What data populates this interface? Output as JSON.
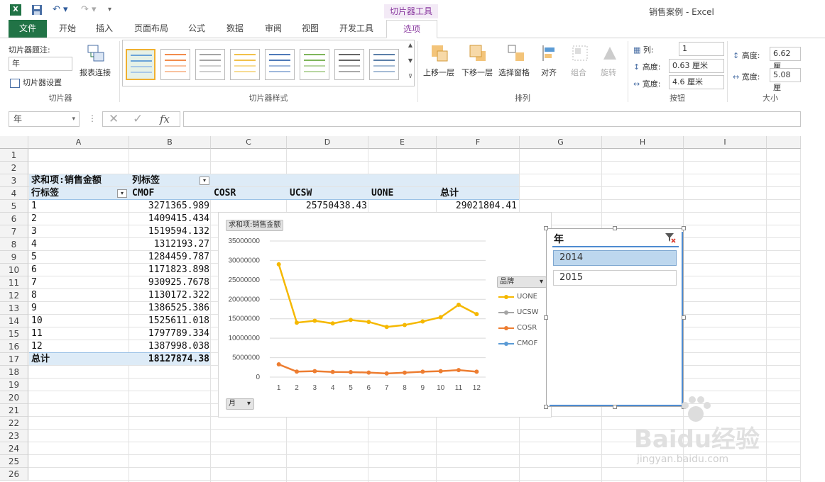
{
  "window": {
    "title": "销售案例 - Excel",
    "context_tools": "切片器工具"
  },
  "tabs": [
    "文件",
    "开始",
    "插入",
    "页面布局",
    "公式",
    "数据",
    "审阅",
    "视图",
    "开发工具",
    "选项"
  ],
  "ribbon": {
    "slicer_caption_label": "切片器题注:",
    "slicer_caption_value": "年",
    "slicer_settings": "切片器设置",
    "report_connections": "报表连接",
    "group_slicer": "切片器",
    "group_styles": "切片器样式",
    "bring_forward": "上移一层",
    "send_backward": "下移一层",
    "selection_pane": "选择窗格",
    "align": "对齐",
    "group_btn": "组合",
    "rotate": "旋转",
    "group_arrange": "排列",
    "columns_label": "列:",
    "columns_value": "1",
    "btn_height_label": "高度:",
    "btn_height_value": "0.63 厘米",
    "btn_width_label": "宽度:",
    "btn_width_value": "4.6 厘米",
    "group_buttons": "按钮",
    "size_height_label": "高度:",
    "size_height_value": "6.62 厘",
    "size_width_label": "宽度:",
    "size_width_value": "5.08 厘",
    "group_size": "大小"
  },
  "formula_bar": {
    "name_box": "年",
    "fx": "fx",
    "content": ""
  },
  "sheet": {
    "columns": [
      "A",
      "B",
      "C",
      "D",
      "E",
      "F",
      "G",
      "H",
      "I"
    ],
    "rows": [
      "1",
      "2",
      "3",
      "4",
      "5",
      "6",
      "7",
      "8",
      "9",
      "10",
      "11",
      "12",
      "13",
      "14",
      "15",
      "16",
      "17",
      "18",
      "19",
      "20",
      "21",
      "22",
      "23",
      "24",
      "25",
      "26"
    ],
    "pivot": {
      "sum_label": "求和项:销售金额",
      "col_label": "列标签",
      "row_label": "行标签",
      "headers": [
        "CMOF",
        "COSR",
        "UCSW",
        "UONE",
        "总计"
      ],
      "months": [
        "1",
        "2",
        "3",
        "4",
        "5",
        "6",
        "7",
        "8",
        "9",
        "10",
        "11",
        "12"
      ],
      "cmof": [
        "3271365.989",
        "1409415.434",
        "1519594.132",
        "1312193.27",
        "1284459.787",
        "1171823.898",
        "930925.7678",
        "1130172.322",
        "1386525.386",
        "1525611.018",
        "1797789.334",
        "1387998.038"
      ],
      "row5_ucsw": "25750438.43",
      "row5_total": "29021804.41",
      "total_label": "总计",
      "total_cmof": "18127874.38"
    }
  },
  "chart_data": {
    "type": "line",
    "field_button": "求和项:销售金额",
    "x_field_button": "月",
    "legend_field_button": "品牌",
    "categories": [
      "1",
      "2",
      "3",
      "4",
      "5",
      "6",
      "7",
      "8",
      "9",
      "10",
      "11",
      "12"
    ],
    "y_ticks": [
      "35000000",
      "30000000",
      "25000000",
      "20000000",
      "15000000",
      "10000000",
      "5000000",
      "0"
    ],
    "ylim": [
      0,
      35000000
    ],
    "legend_position": "right",
    "series": [
      {
        "name": "UONE",
        "color": "#f5b800",
        "values": [
          29000000,
          14000000,
          14500000,
          13800000,
          14700000,
          14200000,
          12900000,
          13400000,
          14300000,
          15400000,
          18600000,
          16200000
        ]
      },
      {
        "name": "UCSW",
        "color": "#a5a5a5",
        "values": []
      },
      {
        "name": "COSR",
        "color": "#ed7d31",
        "values": [
          3271366,
          1409415,
          1519594,
          1312193,
          1284460,
          1171824,
          930926,
          1130172,
          1386525,
          1525611,
          1797789,
          1387998
        ]
      },
      {
        "name": "CMOF",
        "color": "#5b9bd5",
        "values": []
      }
    ]
  },
  "slicer": {
    "title": "年",
    "items": [
      {
        "label": "2014",
        "selected": true
      },
      {
        "label": "2015",
        "selected": false
      }
    ]
  },
  "watermark": {
    "logo": "Baidu经验",
    "url": "jingyan.baidu.com"
  }
}
